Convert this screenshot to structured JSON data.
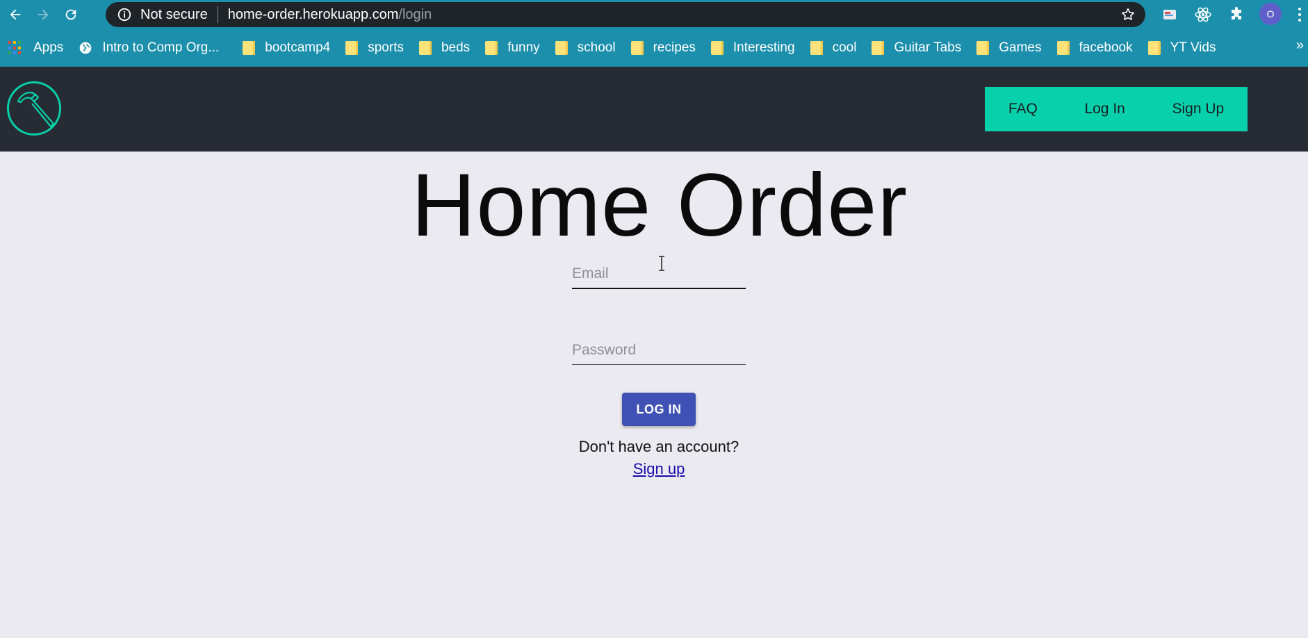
{
  "browser": {
    "security_label": "Not secure",
    "url_host": "home-order.herokuapp.com",
    "url_path": "/login",
    "profile_initial": "O",
    "bookmarks": [
      {
        "label": "Apps",
        "icon": "apps-grid-icon"
      },
      {
        "label": "Intro to Comp Org...",
        "icon": "globe-icon"
      },
      {
        "label": "bootcamp4",
        "icon": "folder-icon"
      },
      {
        "label": "sports",
        "icon": "folder-icon"
      },
      {
        "label": "beds",
        "icon": "folder-icon"
      },
      {
        "label": "funny",
        "icon": "folder-icon"
      },
      {
        "label": "school",
        "icon": "folder-icon"
      },
      {
        "label": "recipes",
        "icon": "folder-icon"
      },
      {
        "label": "Interesting",
        "icon": "folder-icon"
      },
      {
        "label": "cool",
        "icon": "folder-icon"
      },
      {
        "label": "Guitar Tabs",
        "icon": "folder-icon"
      },
      {
        "label": "Games",
        "icon": "folder-icon"
      },
      {
        "label": "facebook",
        "icon": "folder-icon"
      },
      {
        "label": "YT Vids",
        "icon": "folder-icon"
      }
    ],
    "more_label": "»"
  },
  "header": {
    "logo_icon": "hammer-logo-icon",
    "nav": {
      "faq": "FAQ",
      "login": "Log In",
      "signup": "Sign Up"
    }
  },
  "main": {
    "title": "Home Order",
    "email_placeholder": "Email",
    "email_value": "",
    "password_placeholder": "Password",
    "password_value": "",
    "login_button": "LOG IN",
    "no_account_text": "Don't have an account?",
    "signup_link": "Sign up"
  },
  "colors": {
    "chrome": "#1c8fac",
    "header_bg": "#272b33",
    "accent": "#06d1ab",
    "button": "#3f51b5",
    "page_bg": "#ebeaf0"
  }
}
